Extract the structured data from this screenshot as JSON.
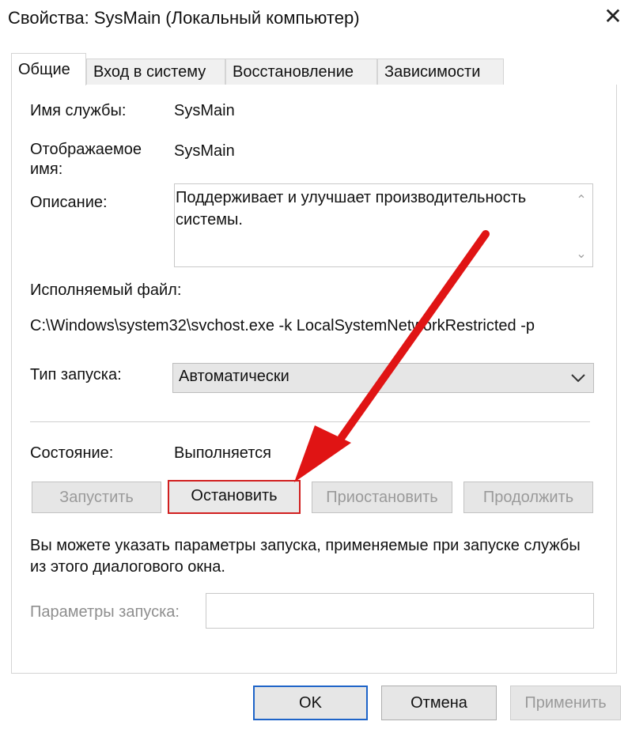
{
  "window": {
    "title": "Свойства: SysMain (Локальный компьютер)",
    "close_label": "✕"
  },
  "tabs": [
    {
      "label": "Общие",
      "active": true
    },
    {
      "label": "Вход в систему",
      "active": false
    },
    {
      "label": "Восстановление",
      "active": false
    },
    {
      "label": "Зависимости",
      "active": false
    }
  ],
  "fields": {
    "service_name_label": "Имя службы:",
    "service_name_value": "SysMain",
    "display_name_label_line1": "Отображаемое",
    "display_name_label_line2": "имя:",
    "display_name_value": "SysMain",
    "description_label": "Описание:",
    "description_text": "Поддерживает и улучшает производительность системы.",
    "executable_label": "Исполняемый файл:",
    "executable_path": "C:\\Windows\\system32\\svchost.exe -k LocalSystemNetworkRestricted -p",
    "startup_type_label": "Тип запуска:",
    "startup_type_value": "Автоматически",
    "status_label": "Состояние:",
    "status_value": "Выполняется"
  },
  "service_buttons": {
    "start": "Запустить",
    "stop": "Остановить",
    "pause": "Приостановить",
    "resume": "Продолжить"
  },
  "params": {
    "hint": "Вы можете указать параметры запуска, применяемые при запуске службы из этого диалогового окна.",
    "label": "Параметры запуска:",
    "value": ""
  },
  "footer": {
    "ok": "OK",
    "cancel": "Отмена",
    "apply": "Применить"
  },
  "colors": {
    "highlight": "#d11f1f",
    "arrow": "#e01414",
    "focus": "#1e64c8"
  }
}
